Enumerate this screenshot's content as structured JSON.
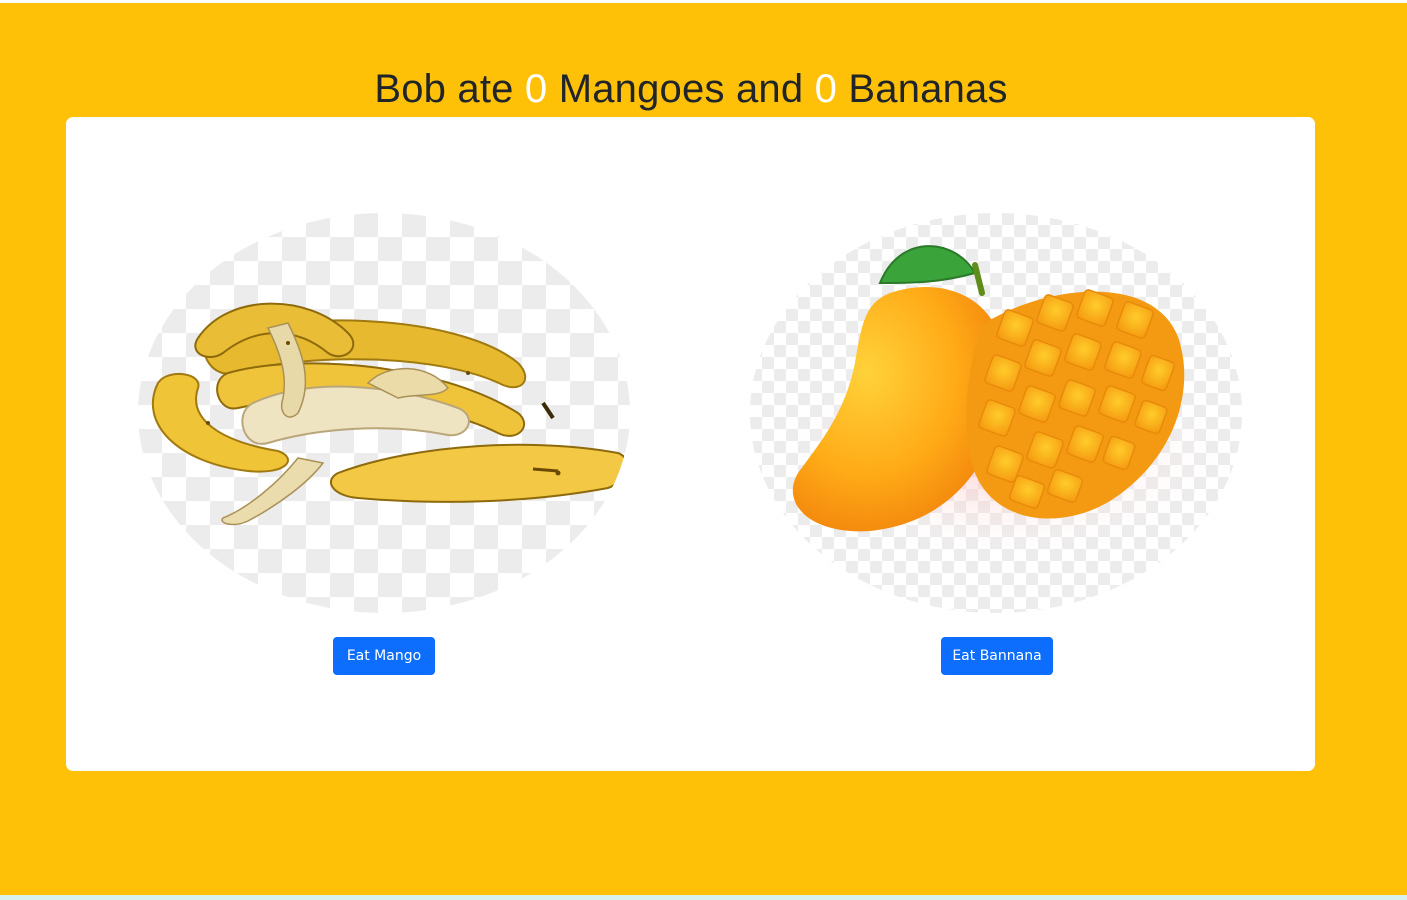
{
  "headline": {
    "prefix": "Bob ate ",
    "mango_count": "0",
    "middle": " Mangoes and ",
    "banana_count": "0",
    "suffix": " Bananas"
  },
  "cards": [
    {
      "image": "banana-bunch-image",
      "button_label": "Eat Mango"
    },
    {
      "image": "mango-image",
      "button_label": "Eat Bannana"
    }
  ],
  "colors": {
    "page_background": "#ffc107",
    "card_background": "#ffffff",
    "button": "#0d6efd",
    "count_highlight": "#ffffff",
    "headline_text": "#212529"
  }
}
